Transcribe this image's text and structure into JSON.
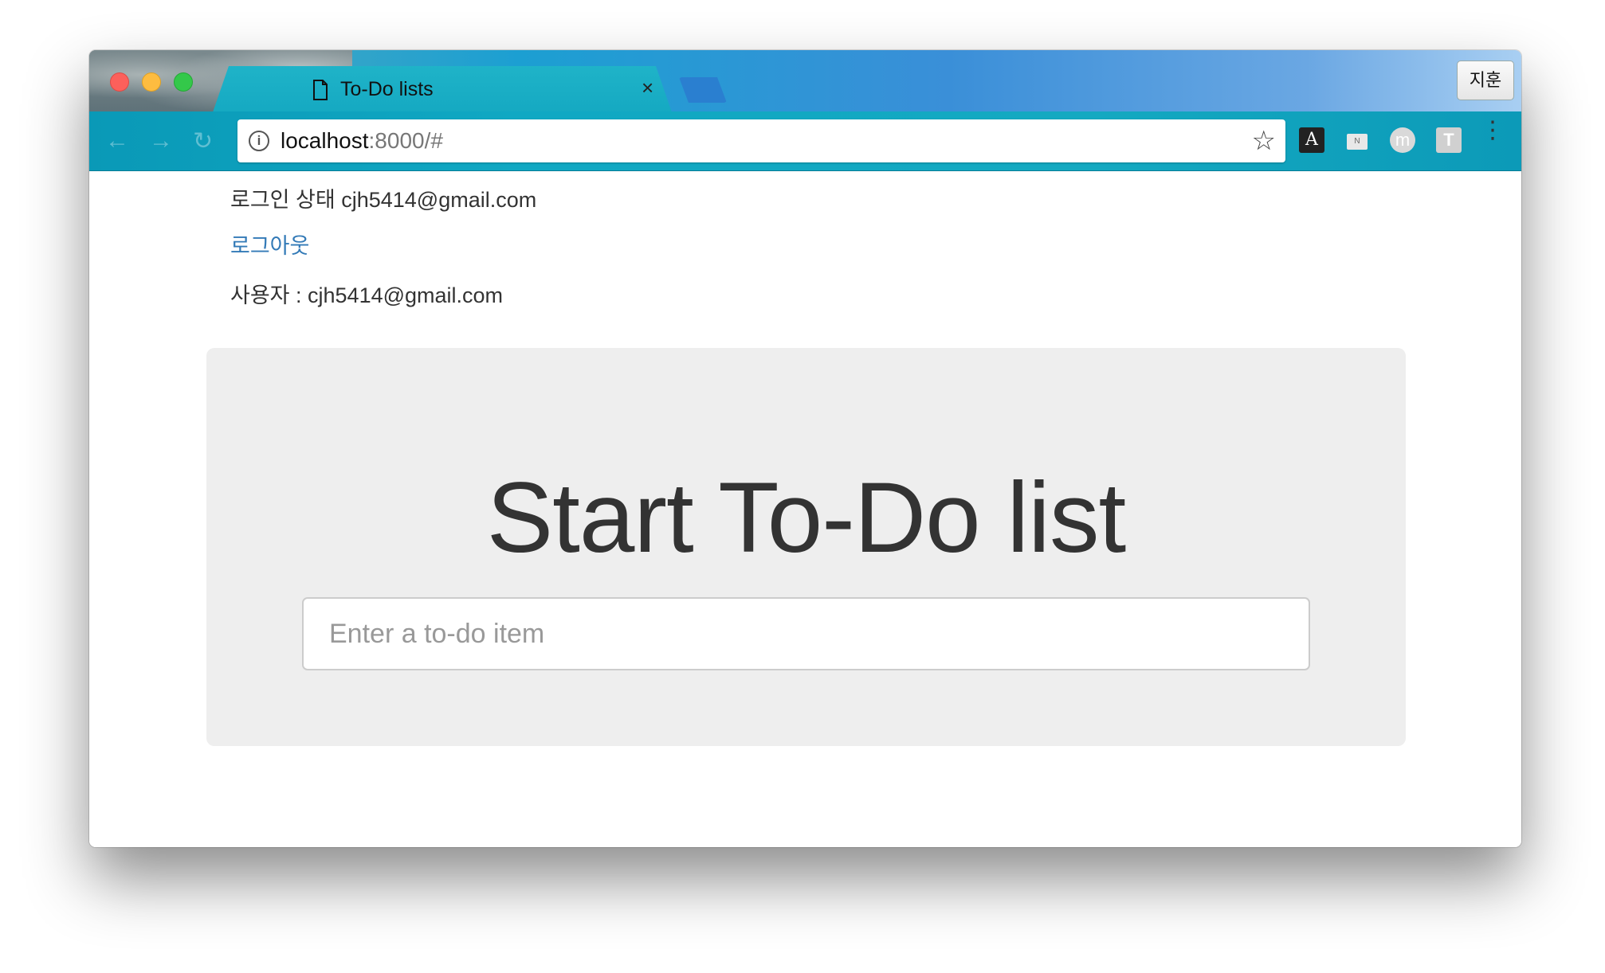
{
  "browser": {
    "tab_title": "To-Do lists",
    "tab_close": "×",
    "profile_name": "지훈",
    "url_host": "localhost",
    "url_rest": ":8000/#",
    "extensions": {
      "a_label": "A",
      "n_label": "N",
      "m_label": "m",
      "t_label": "T"
    }
  },
  "page": {
    "login_status": "로그인 상태 cjh5414@gmail.com",
    "logout_label": "로그아웃",
    "user_line": "사용자 : cjh5414@gmail.com",
    "heading": "Start To-Do list",
    "todo_placeholder": "Enter a to-do item"
  },
  "colors": {
    "link": "#337ab7",
    "jumbotron_bg": "#eeeeee",
    "toolbar": "#10a8c3"
  }
}
